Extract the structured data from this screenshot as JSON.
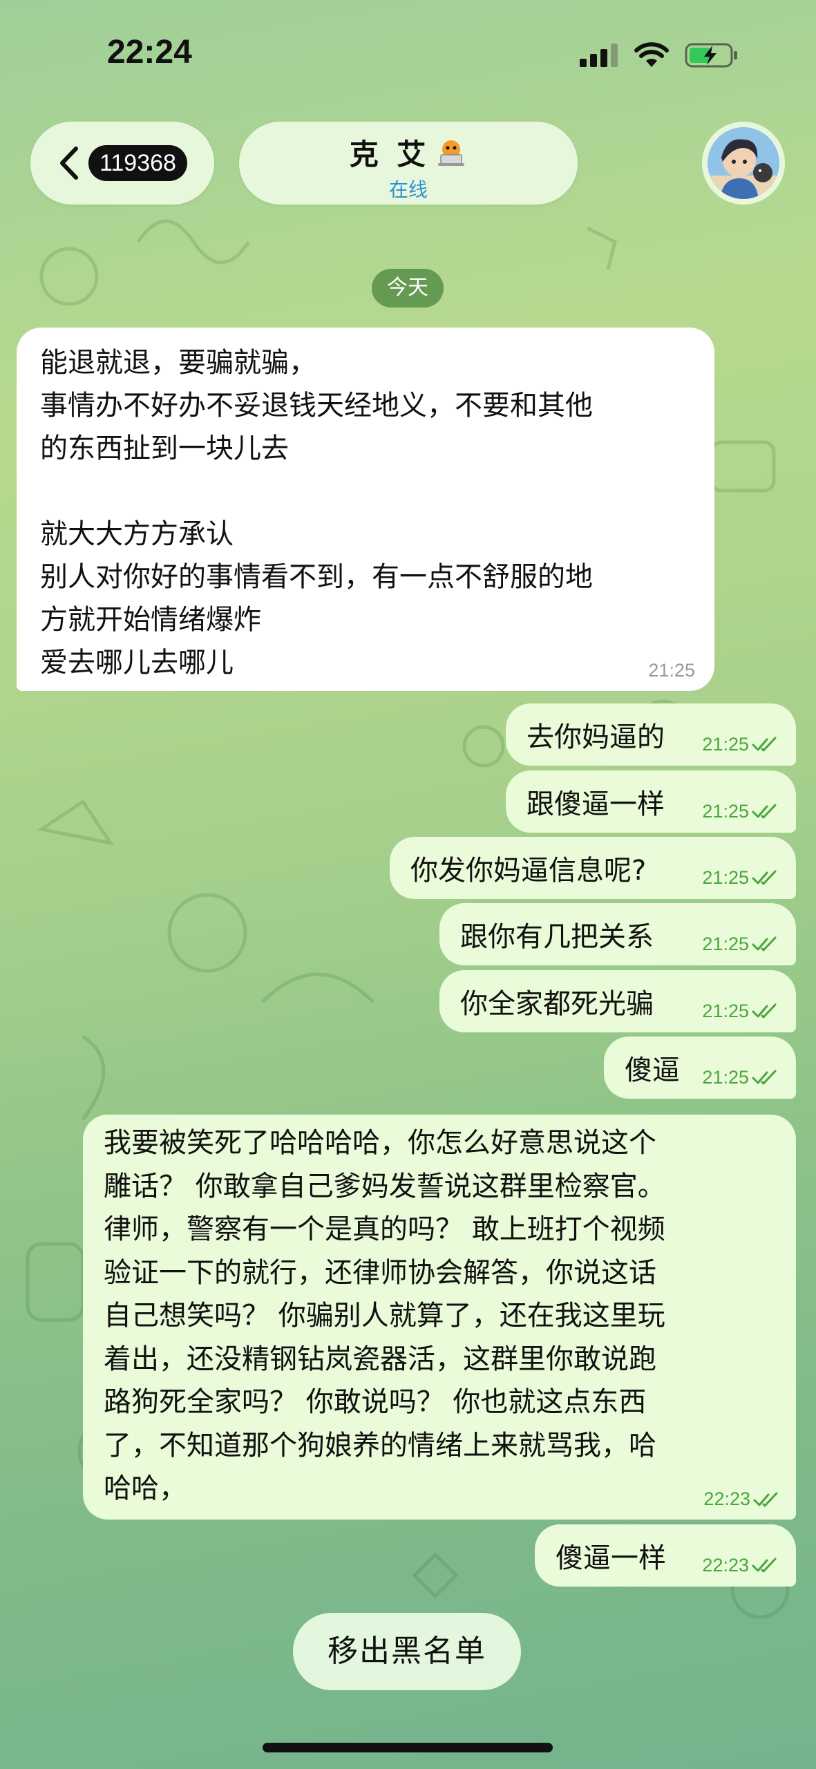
{
  "status_bar": {
    "time": "22:24",
    "icons": [
      "signal-icon",
      "wifi-icon",
      "battery-charging-icon"
    ]
  },
  "header": {
    "back_badge": "119368",
    "chat_name": "克 艾",
    "chat_status": "在线",
    "name_emoji_icon": "laptop-emoji-icon"
  },
  "date_chip": "今天",
  "messages": {
    "incoming": {
      "text": "能退就退，要骗就骗，\n事情办不好办不妥退钱天经地义，不要和其他\n的东西扯到一块儿去\n\n就大大方方承认\n别人对你好的事情看不到，有一点不舒服的地\n方就开始情绪爆炸\n爱去哪儿去哪儿",
      "time": "21:25"
    },
    "outgoing": [
      {
        "text": "去你妈逼的",
        "time": "21:25"
      },
      {
        "text": "跟傻逼一样",
        "time": "21:25"
      },
      {
        "text": "你发你妈逼信息呢?",
        "time": "21:25"
      },
      {
        "text": "跟你有几把关系",
        "time": "21:25"
      },
      {
        "text": "你全家都死光骗",
        "time": "21:25"
      },
      {
        "text": "傻逼",
        "time": "21:25"
      },
      {
        "text": "我要被笑死了哈哈哈哈，你怎么好意思说这个\n雕话？ 你敢拿自己爹妈发誓说这群里检察官。\n律师，警察有一个是真的吗？ 敢上班打个视频\n验证一下的就行，还律师协会解答，你说这话\n自己想笑吗？ 你骗别人就算了，还在我这里玩\n着出，还没精钢钻岚瓷器活，这群里你敢说跑\n路狗死全家吗？ 你敢说吗？ 你也就这点东西\n了，不知道那个狗娘养的情绪上来就骂我，哈\n哈哈，",
        "time": "22:23"
      },
      {
        "text": "傻逼一样",
        "time": "22:23"
      }
    ]
  },
  "footer": {
    "unblock_label": "移出黑名单"
  },
  "colors": {
    "incoming_bubble": "#ffffff",
    "outgoing_bubble": "#e9fbd8",
    "outgoing_time": "#4aa53e",
    "online_status": "#2f8fd6"
  }
}
